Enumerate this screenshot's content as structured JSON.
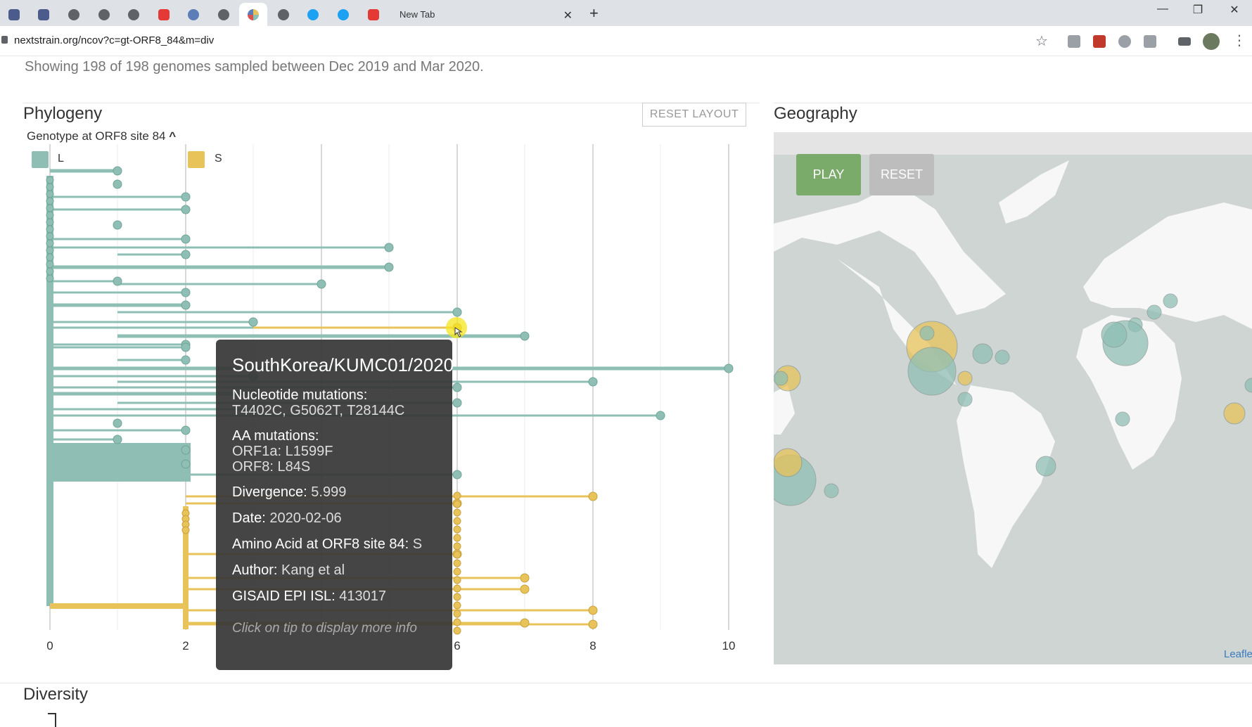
{
  "browser": {
    "tab_title": "New Tab",
    "url": "nextstrain.org/ncov?c=gt-ORF8_84&m=div"
  },
  "page": {
    "summary": "Showing 198 of 198 genomes sampled between Dec 2019 and Mar 2020."
  },
  "phylogeny": {
    "title": "Phylogeny",
    "reset_label": "RESET LAYOUT",
    "color_by": "Genotype at ORF8 site 84",
    "legend": [
      {
        "label": "L",
        "color": "#8fbfb4"
      },
      {
        "label": "S",
        "color": "#e8c35a"
      }
    ],
    "axis_ticks": [
      "0",
      "2",
      "6",
      "8",
      "10"
    ]
  },
  "tooltip": {
    "title": "SouthKorea/KUMC01/2020",
    "nuc_label": "Nucleotide mutations:",
    "nuc_value": "T4402C, G5062T, T28144C",
    "aa_label": "AA mutations:",
    "aa_line1": "ORF1a:  L1599F",
    "aa_line2": "ORF8:  L84S",
    "divergence_label": "Divergence:",
    "divergence_value": "5.999",
    "date_label": "Date:",
    "date_value": "2020-02-06",
    "aa_site_label": "Amino Acid at ORF8 site 84:",
    "aa_site_value": "S",
    "author_label": "Author:",
    "author_value": "Kang et al",
    "gisaid_label": "GISAID EPI ISL:",
    "gisaid_value": "413017",
    "footer": "Click on tip to display more info"
  },
  "geography": {
    "title": "Geography",
    "play_label": "PLAY",
    "reset_label": "RESET",
    "attribution": "Leafle",
    "colors": {
      "play": "#7aab6a",
      "reset": "#bdbdbd",
      "land": "#f7f7f7",
      "water": "#cfd5d3"
    }
  },
  "diversity": {
    "title": "Diversity"
  }
}
